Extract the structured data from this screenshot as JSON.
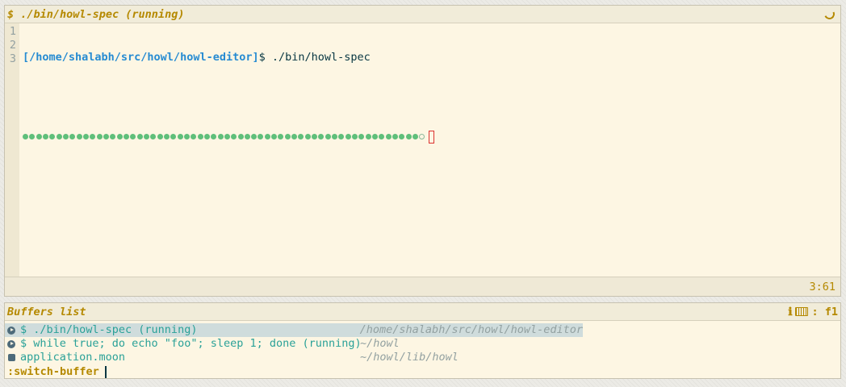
{
  "editor": {
    "title": "$ ./bin/howl-spec (running)",
    "line_numbers": [
      "1",
      "2",
      "3"
    ],
    "prompt_path": "[/home/shalabh/src/howl/howl-editor]",
    "prompt_symbol": "$ ",
    "command": "./bin/howl-spec",
    "progress": {
      "passed_dots": 59,
      "pending_dots": 1
    },
    "cursor_position": "3:61"
  },
  "buffers": {
    "title": "Buffers list",
    "info_keys": ": f1",
    "items": [
      {
        "icon": "play-circle-icon",
        "name": "$ ./bin/howl-spec (running)",
        "dir": "/home/shalabh/src/howl/howl-editor",
        "selected": true
      },
      {
        "icon": "play-circle-icon",
        "name": "$ while true; do echo \"foo\"; sleep 1; done (running)",
        "dir": "~/howl",
        "selected": false
      },
      {
        "icon": "file-square-icon",
        "name": "application.moon",
        "dir": "~/howl/lib/howl",
        "selected": false
      }
    ]
  },
  "command_line": {
    "text": ":switch-buffer"
  },
  "colors": {
    "accent": "#b58900",
    "path": "#268bd2",
    "dot": "#5fbf7a",
    "background": "#fdf6e3"
  }
}
